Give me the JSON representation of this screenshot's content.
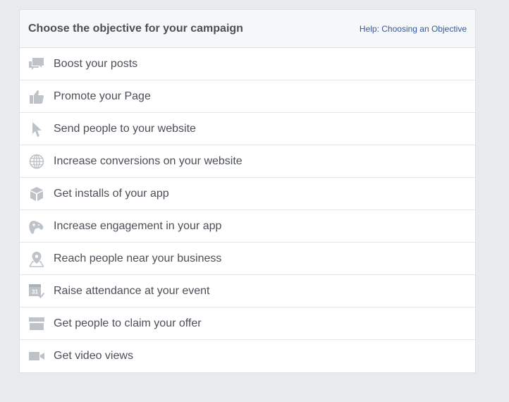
{
  "header": {
    "title": "Choose the objective for your campaign",
    "help_link": "Help: Choosing an Objective"
  },
  "objectives": [
    {
      "label": "Boost your posts",
      "icon": "speech-bubbles-icon"
    },
    {
      "label": "Promote your Page",
      "icon": "thumbs-up-icon"
    },
    {
      "label": "Send people to your website",
      "icon": "cursor-icon"
    },
    {
      "label": "Increase conversions on your website",
      "icon": "globe-icon"
    },
    {
      "label": "Get installs of your app",
      "icon": "cube-icon"
    },
    {
      "label": "Increase engagement in your app",
      "icon": "game-controller-icon"
    },
    {
      "label": "Reach people near your business",
      "icon": "map-pin-icon"
    },
    {
      "label": "Raise attendance at your event",
      "icon": "calendar-icon"
    },
    {
      "label": "Get people to claim your offer",
      "icon": "storefront-icon"
    },
    {
      "label": "Get video views",
      "icon": "video-camera-icon"
    }
  ],
  "calendar_icon_text": "31",
  "colors": {
    "icon": "#bec3c9",
    "text": "#4b4f56",
    "link": "#365899",
    "header_bg": "#f6f7f9",
    "page_bg": "#e9eaed"
  }
}
